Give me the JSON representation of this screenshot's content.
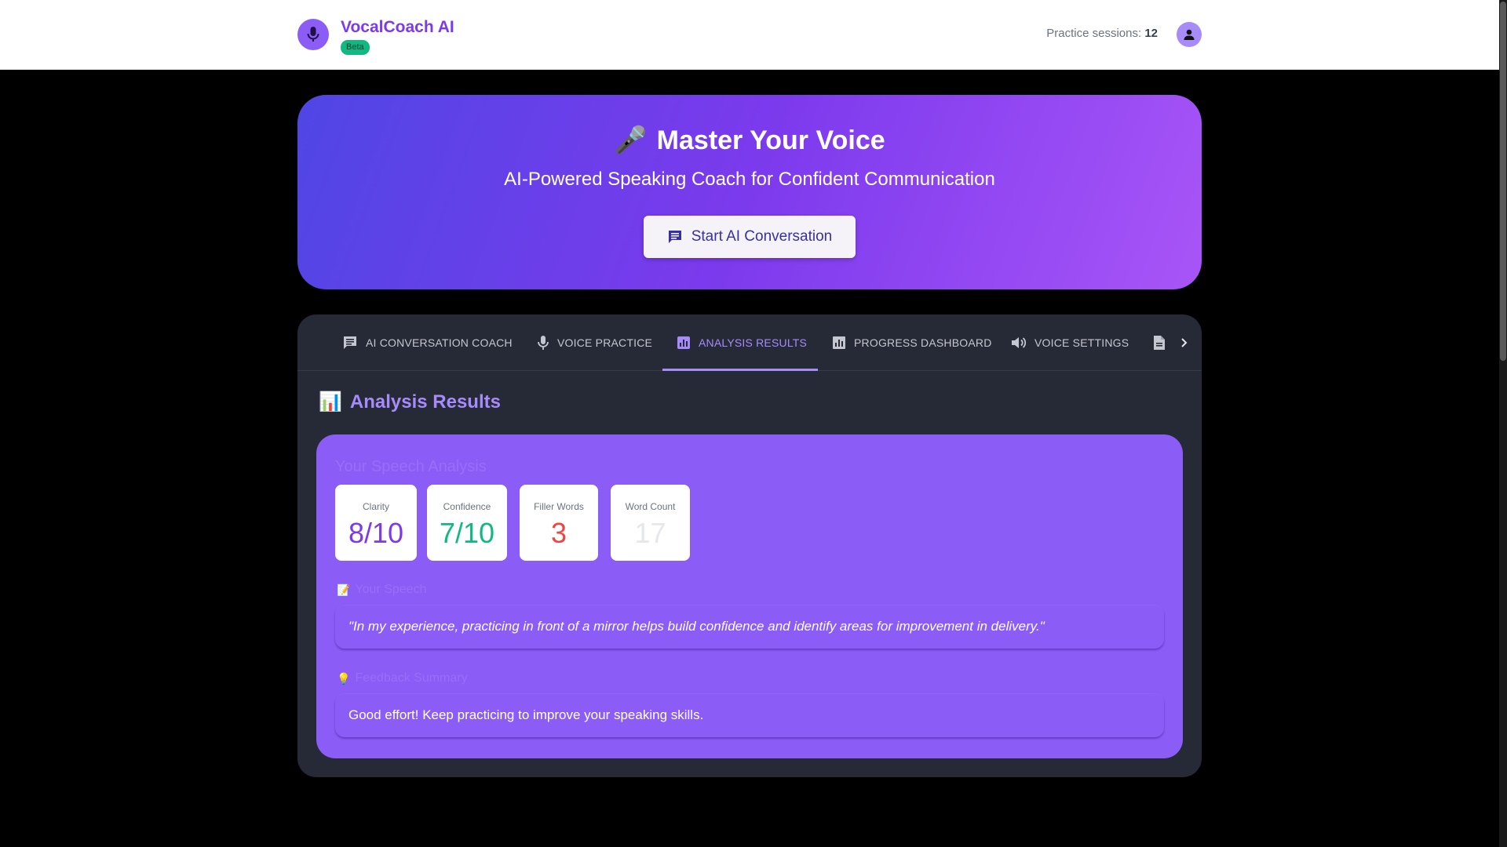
{
  "header": {
    "app_name": "VocalCoach AI",
    "badge": "Beta",
    "sessions_label": "Practice sessions:",
    "sessions_count": "12",
    "icons": {
      "logo": "microphone-icon",
      "avatar": "user-icon"
    }
  },
  "hero": {
    "emoji": "🎤",
    "title": "Master Your Voice",
    "subtitle": "AI-Powered Speaking Coach for Confident Communication",
    "cta_label": "Start AI Conversation",
    "cta_icon": "chat-icon"
  },
  "tabs": [
    {
      "label": "AI Conversation Coach",
      "icon": "chat-icon",
      "active": false
    },
    {
      "label": "Voice Practice",
      "icon": "microphone-icon",
      "active": false
    },
    {
      "label": "Analysis Results",
      "icon": "analytics-icon",
      "active": true
    },
    {
      "label": "Progress Dashboard",
      "icon": "bar-chart-icon",
      "active": false
    },
    {
      "label": "Voice Settings",
      "icon": "speaker-icon",
      "active": false
    },
    {
      "label": "",
      "icon": "document-icon",
      "active": false
    }
  ],
  "section": {
    "emoji": "📊",
    "title": "Analysis Results"
  },
  "analysis": {
    "heading": "Your Speech Analysis",
    "metrics": [
      {
        "label": "Clarity",
        "value": "8/10",
        "color": "#7c3aed"
      },
      {
        "label": "Confidence",
        "value": "7/10",
        "color": "#10b981"
      },
      {
        "label": "Filler Words",
        "value": "3",
        "color": "#ef4444"
      },
      {
        "label": "Word Count",
        "value": "17",
        "color": "#e5e7eb"
      }
    ],
    "speech_label": "Your Speech",
    "speech_emoji": "📝",
    "speech_text": "\"In my experience, practicing in front of a mirror helps build confidence and identify areas for improvement in delivery.\"",
    "feedback_label": "Feedback Summary",
    "feedback_emoji": "💡",
    "feedback_text": "Good effort! Keep practicing to improve your speaking skills."
  },
  "colors": {
    "accent": "#8b5cf6",
    "card_bg": "#262a36",
    "tab_active": "#a78bfa"
  }
}
